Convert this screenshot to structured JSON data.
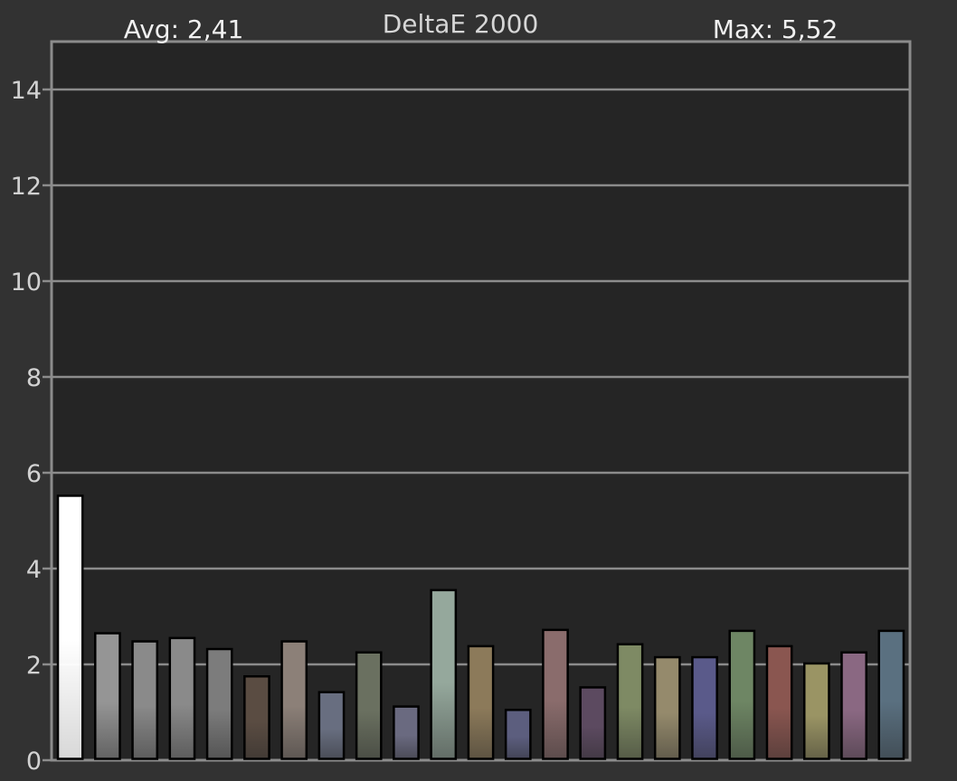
{
  "header": {
    "avg_text": "Avg: 2,41",
    "title": "DeltaE 2000",
    "max_text": "Max: 5,52"
  },
  "colors": {
    "background": "#323232",
    "plot_area": "#252525",
    "grid": "#8c8c8c",
    "text_light": "#f0f0f0",
    "text_title": "#d6d6d6",
    "tick_text": "#d2d2d2"
  },
  "chart_data": {
    "type": "bar",
    "title": "DeltaE 2000",
    "ylim": [
      0,
      15
    ],
    "yticks": [
      0,
      2,
      4,
      6,
      8,
      10,
      12,
      14
    ],
    "grid": true,
    "values": [
      5.52,
      2.65,
      2.48,
      2.55,
      2.32,
      1.75,
      2.48,
      1.42,
      2.25,
      1.12,
      3.55,
      2.38,
      1.05,
      2.72,
      1.52,
      2.42,
      2.15,
      2.15,
      2.7,
      2.38,
      2.02,
      2.25,
      2.7
    ],
    "bar_colors": [
      "#ffffff",
      "#959595",
      "#8a8a8a",
      "#8a8a8a",
      "#7c7c7c",
      "#5a4c42",
      "#8c8078",
      "#686e80",
      "#6a7060",
      "#6a6a80",
      "#95a89c",
      "#8c7a5a",
      "#5c5e7e",
      "#8a6c6c",
      "#5c4a60",
      "#7e8a64",
      "#958a6c",
      "#5a5a8a",
      "#6e8664",
      "#8a5650",
      "#9a9464",
      "#8a6882",
      "#5a7080"
    ]
  }
}
